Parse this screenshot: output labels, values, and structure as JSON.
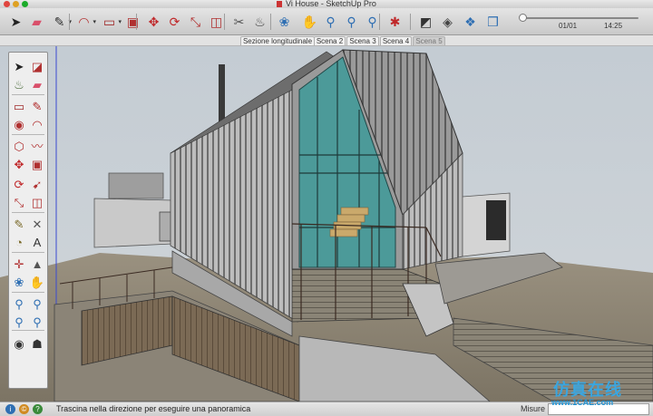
{
  "window": {
    "title": "Vi House - SketchUp Pro",
    "controls": [
      "close",
      "minimize",
      "zoom"
    ]
  },
  "toolbar": {
    "tools": [
      {
        "id": "select",
        "icon": "arrow-icon",
        "glyph": "➤",
        "color": "#222222"
      },
      {
        "id": "eraser",
        "icon": "eraser-icon",
        "glyph": "▰",
        "color": "#d9506b"
      },
      {
        "id": "line",
        "icon": "pencil-icon",
        "glyph": "✎",
        "color": "#333333"
      },
      {
        "id": "arc",
        "icon": "arc-icon",
        "glyph": "◠",
        "color": "#b33030"
      },
      {
        "id": "shapes",
        "icon": "rectangle-icon",
        "glyph": "▭",
        "color": "#a02a2a"
      },
      {
        "id": "pushpull",
        "icon": "pushpull-icon",
        "glyph": "▣",
        "color": "#b03030"
      },
      {
        "id": "move",
        "icon": "move-icon",
        "glyph": "✥",
        "color": "#c0282a"
      },
      {
        "id": "rotate",
        "icon": "rotate-icon",
        "glyph": "⟳",
        "color": "#c0282a"
      },
      {
        "id": "scale",
        "icon": "scale-icon",
        "glyph": "⤡",
        "color": "#b02828"
      },
      {
        "id": "offset",
        "icon": "offset-icon",
        "glyph": "◫",
        "color": "#b03030"
      },
      {
        "id": "tape",
        "icon": "tape-measure-icon",
        "glyph": "✂",
        "color": "#555555"
      },
      {
        "id": "paint",
        "icon": "paint-bucket-icon",
        "glyph": "♨",
        "color": "#444444"
      },
      {
        "id": "orbit",
        "icon": "orbit-icon",
        "glyph": "❀",
        "color": "#2f6fb3"
      },
      {
        "id": "pan",
        "icon": "hand-icon",
        "glyph": "✋",
        "color": "#555555"
      },
      {
        "id": "zoom",
        "icon": "zoom-icon",
        "glyph": "⚲",
        "color": "#2f6fb3"
      },
      {
        "id": "zoom-window",
        "icon": "zoom-window-icon",
        "glyph": "⚲",
        "color": "#2f6fb3"
      },
      {
        "id": "zoom-extents",
        "icon": "zoom-extents-icon",
        "glyph": "⚲",
        "color": "#2f6fb3"
      },
      {
        "id": "warehouse",
        "icon": "warehouse-icon",
        "glyph": "✱",
        "color": "#c0282a"
      },
      {
        "id": "style",
        "icon": "style-icon",
        "glyph": "◩",
        "color": "#333333"
      },
      {
        "id": "views",
        "icon": "views-icon",
        "glyph": "◈",
        "color": "#444444"
      },
      {
        "id": "components",
        "icon": "components-icon",
        "glyph": "❖",
        "color": "#2f6fb3"
      },
      {
        "id": "layers",
        "icon": "layers-icon",
        "glyph": "❒",
        "color": "#2f6fb3"
      }
    ]
  },
  "animation": {
    "frame": "01/01",
    "time": "14:25"
  },
  "scenes": {
    "tabs": [
      {
        "label": "Sezione longitudinale",
        "active": false
      },
      {
        "label": "Scena 2",
        "active": false
      },
      {
        "label": "Scena 3",
        "active": false
      },
      {
        "label": "Scena 4",
        "active": false
      },
      {
        "label": "Scena 5",
        "active": true
      }
    ]
  },
  "palette": {
    "tools": [
      {
        "icon": "select-arrow-icon",
        "glyph": "➤",
        "color": "#222222"
      },
      {
        "icon": "make-component-icon",
        "glyph": "◪",
        "color": "#b03030"
      },
      {
        "icon": "paint-bucket-icon",
        "glyph": "♨",
        "color": "#4a6b3a"
      },
      {
        "icon": "eraser-icon",
        "glyph": "▰",
        "color": "#d9506b"
      },
      {
        "icon": "rectangle-icon",
        "glyph": "▭",
        "color": "#a02a2a"
      },
      {
        "icon": "pencil-icon",
        "glyph": "✎",
        "color": "#b02a2a"
      },
      {
        "icon": "circle-icon",
        "glyph": "◉",
        "color": "#b03030"
      },
      {
        "icon": "arc-icon",
        "glyph": "◠",
        "color": "#b03030"
      },
      {
        "icon": "polygon-icon",
        "glyph": "⬡",
        "color": "#b03030"
      },
      {
        "icon": "freehand-icon",
        "glyph": "〰",
        "color": "#b03030"
      },
      {
        "icon": "move-icon",
        "glyph": "✥",
        "color": "#c0282a"
      },
      {
        "icon": "pushpull-icon",
        "glyph": "▣",
        "color": "#b03030"
      },
      {
        "icon": "rotate-icon",
        "glyph": "⟳",
        "color": "#c0282a"
      },
      {
        "icon": "followme-icon",
        "glyph": "➹",
        "color": "#b03030"
      },
      {
        "icon": "scale-icon",
        "glyph": "⤡",
        "color": "#b02828"
      },
      {
        "icon": "offset-icon",
        "glyph": "◫",
        "color": "#b03030"
      },
      {
        "icon": "tape-measure-icon",
        "glyph": "✎",
        "color": "#7a6a2a"
      },
      {
        "icon": "dimension-icon",
        "glyph": "✕",
        "color": "#555555"
      },
      {
        "icon": "protractor-icon",
        "glyph": "◔",
        "color": "#7a6a2a"
      },
      {
        "icon": "text-label-icon",
        "glyph": "A",
        "color": "#333333"
      },
      {
        "icon": "axes-icon",
        "glyph": "✛",
        "color": "#b03030"
      },
      {
        "icon": "3d-text-icon",
        "glyph": "▲",
        "color": "#555555"
      },
      {
        "icon": "orbit-icon",
        "glyph": "❀",
        "color": "#2f6fb3"
      },
      {
        "icon": "pan-hand-icon",
        "glyph": "✋",
        "color": "#555555"
      },
      {
        "icon": "zoom-icon",
        "glyph": "⚲",
        "color": "#2f6fb3"
      },
      {
        "icon": "zoom-window-icon",
        "glyph": "⚲",
        "color": "#2f6fb3"
      },
      {
        "icon": "zoom-extents-icon",
        "glyph": "⚲",
        "color": "#2f6fb3"
      },
      {
        "icon": "previous-view-icon",
        "glyph": "⚲",
        "color": "#2f6fb3"
      },
      {
        "icon": "position-camera-icon",
        "glyph": "◉",
        "color": "#333333"
      },
      {
        "icon": "walk-icon",
        "glyph": "☗",
        "color": "#333333"
      }
    ]
  },
  "status": {
    "message": "Trascina nella direzione per eseguire una panoramica",
    "measure_label": "Misure",
    "icons": [
      {
        "icon": "geo-location-icon",
        "glyph": "i",
        "color": "#2f6fb3"
      },
      {
        "icon": "credits-icon",
        "glyph": "©",
        "color": "#d08a20"
      },
      {
        "icon": "help-icon",
        "glyph": "?",
        "color": "#3a8a3a"
      }
    ]
  },
  "watermark": {
    "cn": "仿真在线",
    "url": "www.1CAE.com"
  },
  "colors": {
    "sky": "#c8d0d7",
    "ground": "#8a8170",
    "glass": "#4c9a99",
    "roof": "#8f8f8f",
    "accent_red": "#c0282a",
    "accent_blue": "#2f6fb3"
  }
}
